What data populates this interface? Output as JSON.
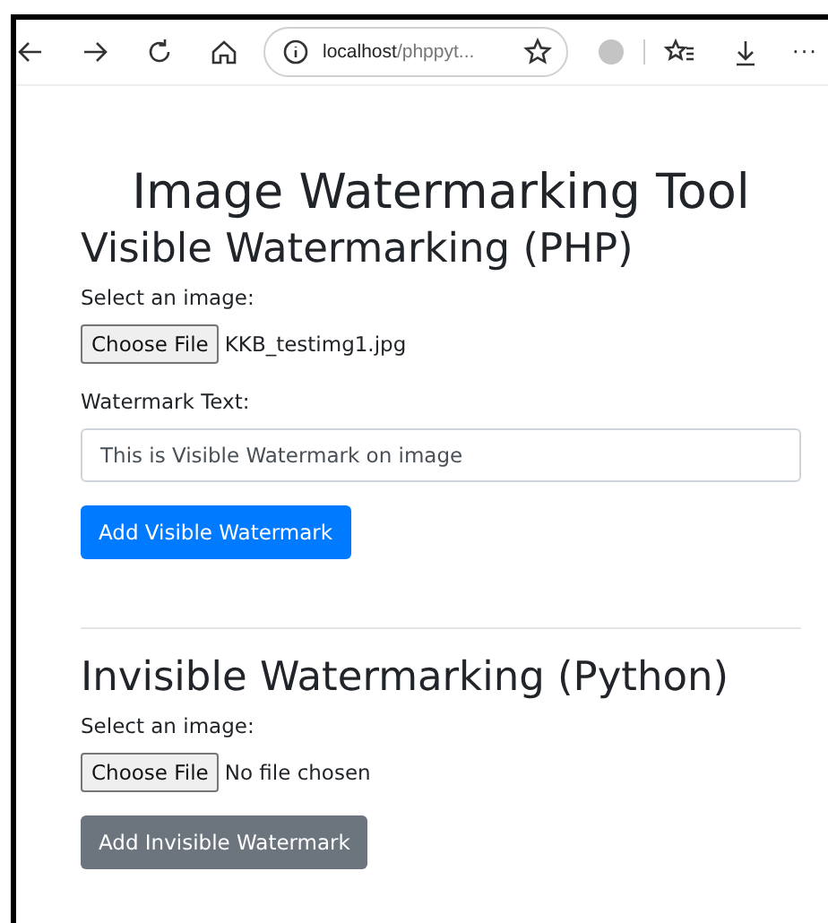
{
  "browser": {
    "url_host": "localhost",
    "url_path": "/phppyt...",
    "more": "···"
  },
  "title": "Image Watermarking Tool",
  "sections": [
    {
      "heading": "Visible Watermarking (PHP)",
      "file_label": "Select an image:",
      "file_button": "Choose File",
      "file_name": "KKB_testimg1.jpg",
      "text_label": "Watermark Text:",
      "text_value": "This is Visible Watermark on image",
      "submit": {
        "label": "Add Visible Watermark",
        "kind": "primary"
      }
    },
    {
      "heading": "Invisible Watermarking (Python)",
      "file_label": "Select an image:",
      "file_button": "Choose File",
      "file_name": "No file chosen",
      "submit": {
        "label": "Add Invisible Watermark",
        "kind": "secondary"
      }
    }
  ]
}
